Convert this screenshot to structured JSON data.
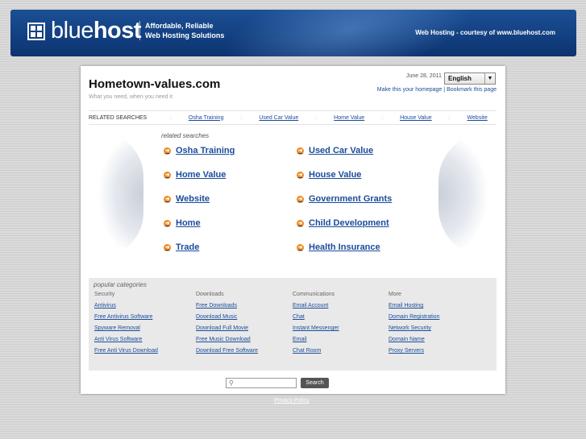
{
  "header": {
    "logo_light": "blue",
    "logo_bold": "host",
    "tagline_1": "Affordable, Reliable",
    "tagline_2": "Web Hosting Solutions",
    "courtesy": "Web Hosting - courtesy of www.bluehost.com"
  },
  "site": {
    "title": "Hometown-values.com",
    "subtitle": "What you need, when you need it",
    "date": "June 28, 2011",
    "language": "English",
    "make_homepage": "Make this your homepage",
    "separator": "|",
    "bookmark": "Bookmark this page"
  },
  "related_bar": {
    "label": "RELATED SEARCHES",
    "links": [
      "Osha Training",
      "Used Car Value",
      "Home Value",
      "House Value",
      "Website"
    ]
  },
  "related": {
    "heading": "related searches",
    "left": [
      "Osha Training",
      "Home Value",
      "Website",
      "Home",
      "Trade"
    ],
    "right": [
      "Used Car Value",
      "House Value",
      "Government Grants",
      "Child Development",
      "Health Insurance"
    ]
  },
  "popular": {
    "title": "popular categories",
    "columns": [
      {
        "heading": "Security",
        "links": [
          "Antivirus",
          "Free Antivirus Software",
          "Spyware Removal",
          "Anti Virus Software",
          "Free Anti Virus Download"
        ]
      },
      {
        "heading": "Downloads",
        "links": [
          "Free Downloads",
          "Download Music",
          "Download Full Movie",
          "Free Music Download",
          "Download Free Software"
        ]
      },
      {
        "heading": "Communications",
        "links": [
          "Email Account",
          "Chat",
          "Instant Messenger",
          "Email",
          "Chat Room"
        ]
      },
      {
        "heading": "More",
        "links": [
          "Email Hosting",
          "Domain Registration",
          "Network Security",
          "Domain Name",
          "Proxy Servers"
        ]
      }
    ]
  },
  "search": {
    "placeholder": "",
    "button": "Search"
  },
  "footer": {
    "privacy": "Privacy Policy"
  },
  "colors": {
    "banner": "#1c4f95",
    "link": "#1a4c9a",
    "bullet": "#f28a1c"
  }
}
